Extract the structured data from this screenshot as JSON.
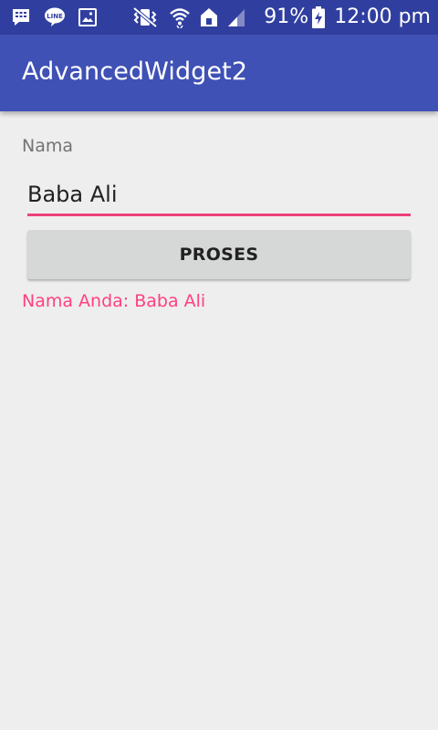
{
  "status_bar": {
    "left_icons": [
      "bbm-icon",
      "line-icon",
      "gallery-icon"
    ],
    "right_icons": [
      "vibrate-icon",
      "wifi-icon",
      "home-icon",
      "signal-icon"
    ],
    "battery_percent": "91%",
    "time": "12:00 pm",
    "color": "#303f9f"
  },
  "app_bar": {
    "title": "AdvancedWidget2",
    "color": "#3f51b5"
  },
  "form": {
    "name_label": "Nama",
    "name_value": "Baba Ali",
    "accent_color": "#ec407a",
    "submit_label": "PROSES",
    "result_text": "Nama Anda: Baba Ali",
    "result_color": "#ff4081"
  }
}
